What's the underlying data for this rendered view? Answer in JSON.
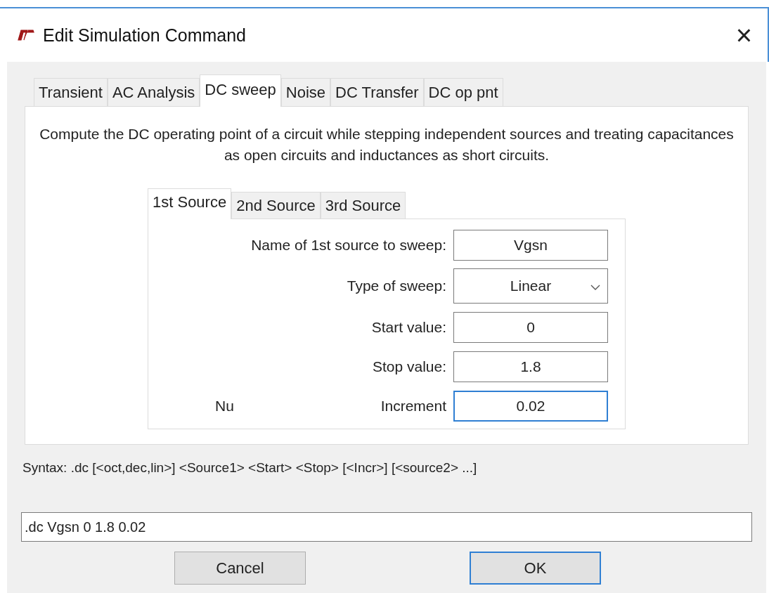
{
  "window": {
    "title": "Edit Simulation Command",
    "close": "×"
  },
  "tabs": [
    {
      "label": "Transient",
      "selected": false
    },
    {
      "label": "AC Analysis",
      "selected": false
    },
    {
      "label": "DC sweep",
      "selected": true
    },
    {
      "label": "Noise",
      "selected": false
    },
    {
      "label": "DC Transfer",
      "selected": false
    },
    {
      "label": "DC op pnt",
      "selected": false
    }
  ],
  "description": "Compute the DC operating point of a circuit while stepping independent sources and treating capacitances as open circuits and inductances as short circuits.",
  "source_tabs": [
    {
      "label": "1st Source",
      "selected": true
    },
    {
      "label": "2nd Source",
      "selected": false
    },
    {
      "label": "3rd Source",
      "selected": false
    }
  ],
  "fields": [
    {
      "kind": "text",
      "label": "Name of 1st source to sweep:",
      "value": "Vgsn",
      "focused": false
    },
    {
      "kind": "dropdown",
      "label": "Type of sweep:",
      "value": "Linear",
      "focused": false
    },
    {
      "kind": "text",
      "label": "Start value:",
      "value": "0",
      "focused": false
    },
    {
      "kind": "text",
      "label": "Stop value:",
      "value": "1.8",
      "focused": false
    },
    {
      "kind": "text",
      "label": "Increment",
      "value": "0.02",
      "focused": true,
      "note": "Nu"
    }
  ],
  "syntax": "Syntax:  .dc [<oct,dec,lin>] <Source1> <Start> <Stop> [<Incr>] [<source2> ...]",
  "command": ".dc Vgsn 0 1.8 0.02",
  "buttons": [
    {
      "label": "Cancel",
      "default": false
    },
    {
      "label": "OK",
      "default": true
    }
  ]
}
